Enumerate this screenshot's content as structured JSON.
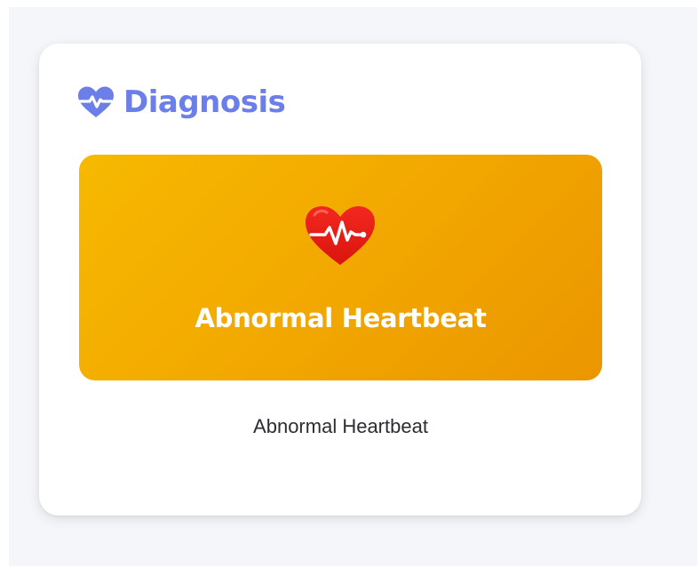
{
  "diagnosis_card": {
    "header": {
      "title": "Diagnosis",
      "icon": "heart-pulse-icon",
      "accent_color": "#6c7fe8"
    },
    "banner": {
      "title": "Abnormal Heartbeat",
      "icon": "heart-pulse-icon",
      "background_color_start": "#f7b900",
      "background_color_end": "#eb9600",
      "icon_color": "#e8231d"
    },
    "caption": "Abnormal Heartbeat"
  }
}
